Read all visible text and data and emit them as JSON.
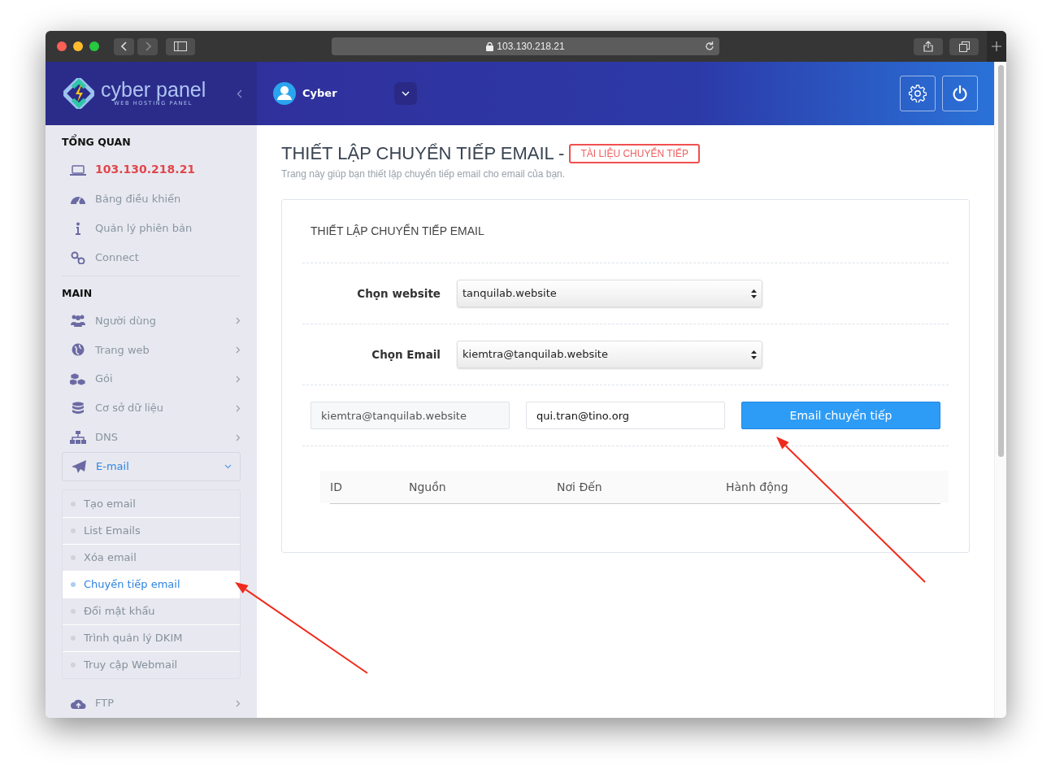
{
  "browser": {
    "url": "103.130.218.21"
  },
  "brand": {
    "name": "cyber panel",
    "tagline": "WEB HOSTING PANEL"
  },
  "sidebar": {
    "sections": [
      {
        "heading": "TỔNG QUAN",
        "items": [
          {
            "label": "103.130.218.21",
            "kind": "accent"
          },
          {
            "label": "Bảng điều khiển",
            "kind": "link"
          },
          {
            "label": "Quản lý phiên bản",
            "kind": "link"
          },
          {
            "label": "Connect",
            "kind": "link"
          }
        ]
      },
      {
        "heading": "MAIN",
        "items": [
          {
            "label": "Người dùng",
            "kind": "menu",
            "expanded": false
          },
          {
            "label": "Trang web",
            "kind": "menu",
            "expanded": false
          },
          {
            "label": "Gói",
            "kind": "menu",
            "expanded": false
          },
          {
            "label": "Cơ sở dữ liệu",
            "kind": "menu",
            "expanded": false
          },
          {
            "label": "DNS",
            "kind": "menu",
            "expanded": false
          },
          {
            "label": "E-mail",
            "kind": "menu",
            "expanded": true,
            "children": [
              {
                "label": "Tạo email",
                "selected": false
              },
              {
                "label": "List Emails",
                "selected": false
              },
              {
                "label": "Xóa email",
                "selected": false
              },
              {
                "label": "Chuyển tiếp email",
                "selected": true
              },
              {
                "label": "Đổi mật khẩu",
                "selected": false
              },
              {
                "label": "Trình quản lý DKIM",
                "selected": false
              },
              {
                "label": "Truy cập Webmail",
                "selected": false
              }
            ]
          },
          {
            "label": "FTP",
            "kind": "menu",
            "expanded": false
          }
        ]
      }
    ]
  },
  "header": {
    "user": "Cyber"
  },
  "page": {
    "title": "THIẾT LẬP CHUYỂN TIẾP EMAIL -",
    "doc_link": "TÀI LIỆU CHUYỂN TIẾP",
    "subtitle": "Trang này giúp bạn thiết lập chuyển tiếp email cho email của bạn."
  },
  "card": {
    "heading": "THIẾT LẬP CHUYỂN TIẾP EMAIL",
    "selects": [
      {
        "label": "Chọn website",
        "value": "tanquilab.website"
      },
      {
        "label": "Chọn Email",
        "value": "kiemtra@tanquilab.website"
      }
    ],
    "inputs": [
      {
        "value": "kiemtra@tanquilab.website",
        "readonly": true
      },
      {
        "value": "qui.tran@tino.org",
        "readonly": false
      }
    ],
    "button": "Email chuyển tiếp",
    "table": {
      "columns": [
        "ID",
        "Nguồn",
        "Nơi Đến",
        "Hành động"
      ]
    }
  }
}
